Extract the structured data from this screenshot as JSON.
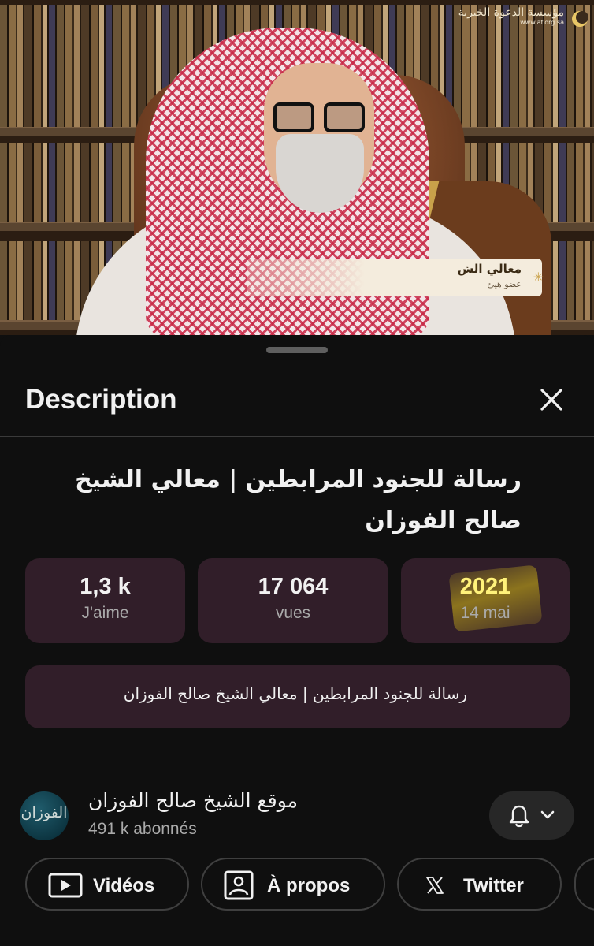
{
  "video": {
    "channel_logo_text": "مؤسسة الدعوة الخيرية",
    "channel_logo_url": "www.af.org.sa",
    "lower_third_name": "معالي الش",
    "lower_third_sub": "عضو هيئ"
  },
  "sheet": {
    "header_title": "Description",
    "video_title": "رسالة للجنود المرابطين | معالي الشيخ صالح الفوزان",
    "stats": {
      "likes_value": "1,3 k",
      "likes_label": "J'aime",
      "views_value": "17 064",
      "views_label": "vues",
      "year_value": "2021",
      "date_label": "14 mai",
      "highlight_color": "#d6ba14"
    },
    "description_text": "رسالة للجنود المرابطين | معالي الشيخ صالح الفوزان",
    "channel": {
      "avatar_text": "الفوزان",
      "name": "موقع الشيخ صالح الفوزان",
      "subscribers": "491 k abonnés"
    },
    "chips": [
      {
        "label": "Vidéos",
        "icon": "video-icon"
      },
      {
        "label": "À propos",
        "icon": "profile-icon"
      },
      {
        "label": "Twitter",
        "icon": "x-logo-icon"
      }
    ]
  },
  "colors": {
    "background": "#0f0f0f",
    "card": "#311e29",
    "secondary_text": "#aaaaaa"
  }
}
